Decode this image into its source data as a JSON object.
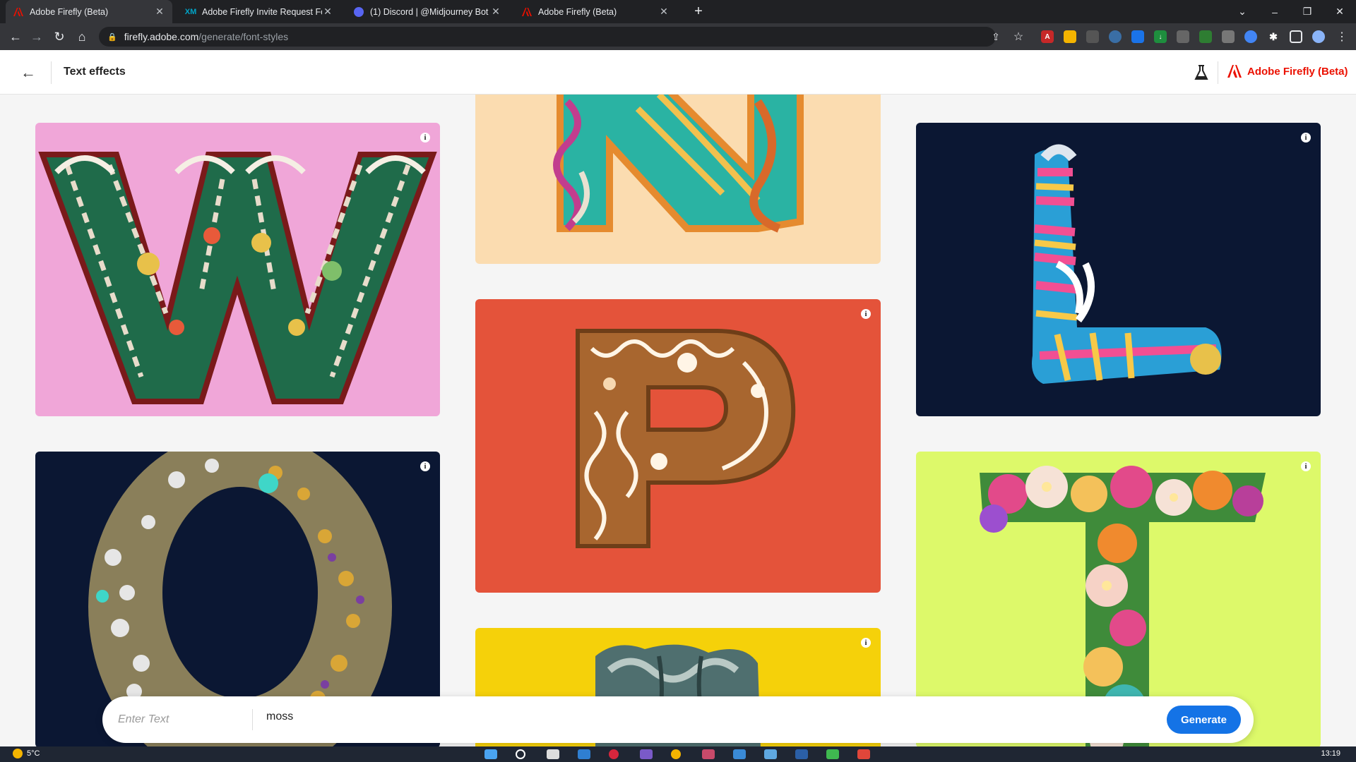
{
  "browser": {
    "tabs": [
      {
        "title": "Adobe Firefly (Beta)",
        "active": true,
        "icon": "adobe-icon"
      },
      {
        "title": "Adobe Firefly Invite Request Form",
        "active": false,
        "icon": "xm-icon"
      },
      {
        "title": "(1) Discord | @Midjourney Bot",
        "active": false,
        "icon": "discord-icon"
      },
      {
        "title": "Adobe Firefly (Beta)",
        "active": false,
        "icon": "adobe-icon"
      }
    ],
    "url_host": "firefly.adobe.com",
    "url_path": "/generate/font-styles"
  },
  "header": {
    "title": "Text effects",
    "brand": "Adobe Firefly (Beta)"
  },
  "gallery": {
    "cards": [
      {
        "letter": "W",
        "background": "#f0a6d8",
        "style": "embroidery"
      },
      {
        "letter": "N",
        "background": "#fbdcb0",
        "style": "yarn"
      },
      {
        "letter": "L",
        "background": "#0b1733",
        "style": "socks"
      },
      {
        "letter": "P",
        "background": "#e4533a",
        "style": "gingerbread"
      },
      {
        "letter": "O",
        "background": "#0b1733",
        "style": "sequins"
      },
      {
        "letter": "T",
        "background": "#ddf96a",
        "style": "flowers"
      },
      {
        "letter": "",
        "background": "#f5d10a",
        "style": "fabric"
      }
    ]
  },
  "prompt": {
    "text_placeholder": "Enter Text",
    "style_value": "moss",
    "generate_label": "Generate"
  },
  "taskbar": {
    "temperature": "5°C",
    "time": "13:19"
  },
  "colors": {
    "accent": "#1473e6",
    "adobe_red": "#eb1000"
  }
}
